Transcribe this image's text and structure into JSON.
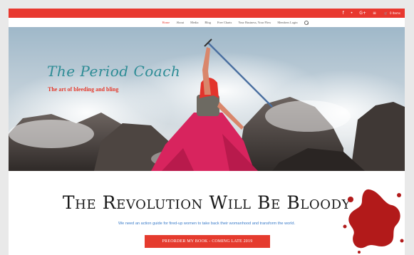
{
  "topbar": {
    "social_icons": [
      "facebook-icon",
      "twitter-icon",
      "google-plus-icon",
      "rss-icon"
    ],
    "social_glyphs": [
      "f",
      "•",
      "G+",
      "≡"
    ],
    "cart_label": "0 Items"
  },
  "nav": {
    "items": [
      {
        "label": "Home",
        "active": true
      },
      {
        "label": "About"
      },
      {
        "label": "Media"
      },
      {
        "label": "Blog"
      },
      {
        "label": "Free Charts"
      },
      {
        "label": "Your Business, Your Flow"
      },
      {
        "label": "Members Login"
      }
    ]
  },
  "hero": {
    "title": "The Period Coach",
    "tagline": "The art of bleeding and bling"
  },
  "main": {
    "headline": "The Revolution Will Be Bloody",
    "subline": "We need an action guide for fired-up women to take back their womanhood and transform the world.",
    "cta_label": "PREORDER MY BOOK - COMING LATE 2019"
  },
  "colors": {
    "accent": "#e8382f",
    "title_teal": "#2d8c95",
    "link_blue": "#3b7cc9"
  }
}
